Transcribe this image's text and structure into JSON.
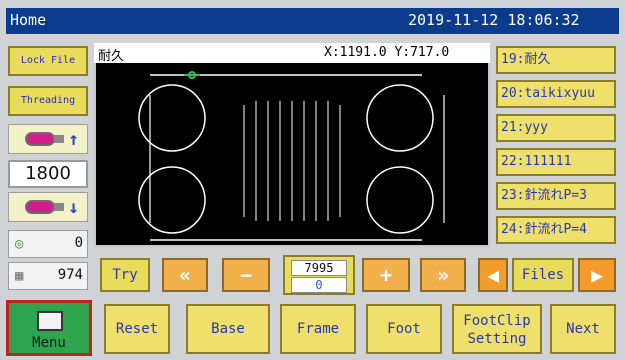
{
  "titlebar": {
    "title": "Home",
    "datetime": "2019-11-12  18:06:32"
  },
  "left": {
    "lock_file": "Lock File",
    "threading": "Threading",
    "speed_value": "1800",
    "counter_left": "0",
    "counter_right": "974"
  },
  "canvas": {
    "name": "耐久",
    "coords": "X:1191.0  Y:717.0"
  },
  "right_list": [
    "19:耐久",
    "20:taikixyuu",
    "21:yyy",
    "22:111111",
    "23:針流れP=3",
    "24:針流れP=4"
  ],
  "controls": {
    "try": "Try",
    "prev_fast": "«",
    "minus": "−",
    "stitch_total": "7995",
    "stitch_current": "0",
    "plus": "+",
    "next_fast": "»",
    "files": "Files"
  },
  "bottom": {
    "menu": "Menu",
    "reset": "Reset",
    "base": "Base",
    "frame": "Frame",
    "foot": "Foot",
    "footclip": "FootClip\nSetting",
    "next": "Next"
  },
  "colors": {
    "title_bg": "#0b3b8c",
    "button_yellow": "#efe06b",
    "menu_green": "#2ea44f",
    "menu_border": "#c52020"
  }
}
